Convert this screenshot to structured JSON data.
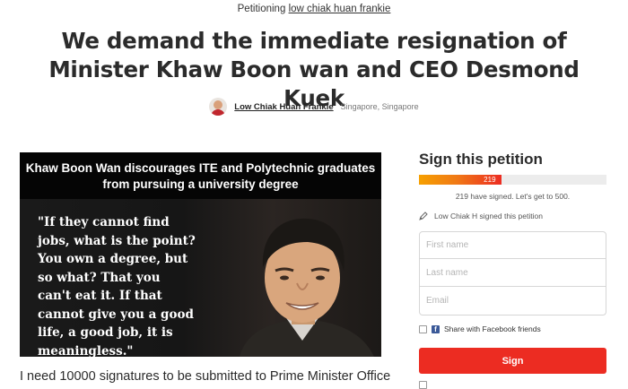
{
  "header": {
    "petitioning_prefix": "Petitioning",
    "petitioning_target": "low chiak huan frankie",
    "headline": "We demand the immediate resignation of Minister Khaw Boon wan and CEO Desmond Kuek"
  },
  "author": {
    "name": "Low Chiak Huan Frankie",
    "location": "Singapore, Singapore"
  },
  "hero_image": {
    "caption": "Khaw Boon Wan discourages ITE and Polytechnic graduates from pursuing a university degree",
    "quote": "\"If they cannot find\njobs, what is the point?\nYou own a degree, but\nso what? That you\ncan't eat it. If that\ncannot give you a good\nlife, a good job, it is\nmeaningless.\""
  },
  "body": {
    "intro": "I need 10000 signatures to be submitted to Prime Minister Office"
  },
  "sign_panel": {
    "title": "Sign this petition",
    "progress_value": 219,
    "progress_goal": 500,
    "progress_label": "219",
    "signed_text": "219 have signed. Let's get to 500.",
    "recent_signer": "Low Chiak H signed this petition",
    "first_name_placeholder": "First name",
    "last_name_placeholder": "Last name",
    "email_placeholder": "Email",
    "facebook_share_label": "Share with Facebook friends",
    "sign_button": "Sign",
    "accent_color": "#ec2c22",
    "facebook_color": "#3b5998"
  }
}
